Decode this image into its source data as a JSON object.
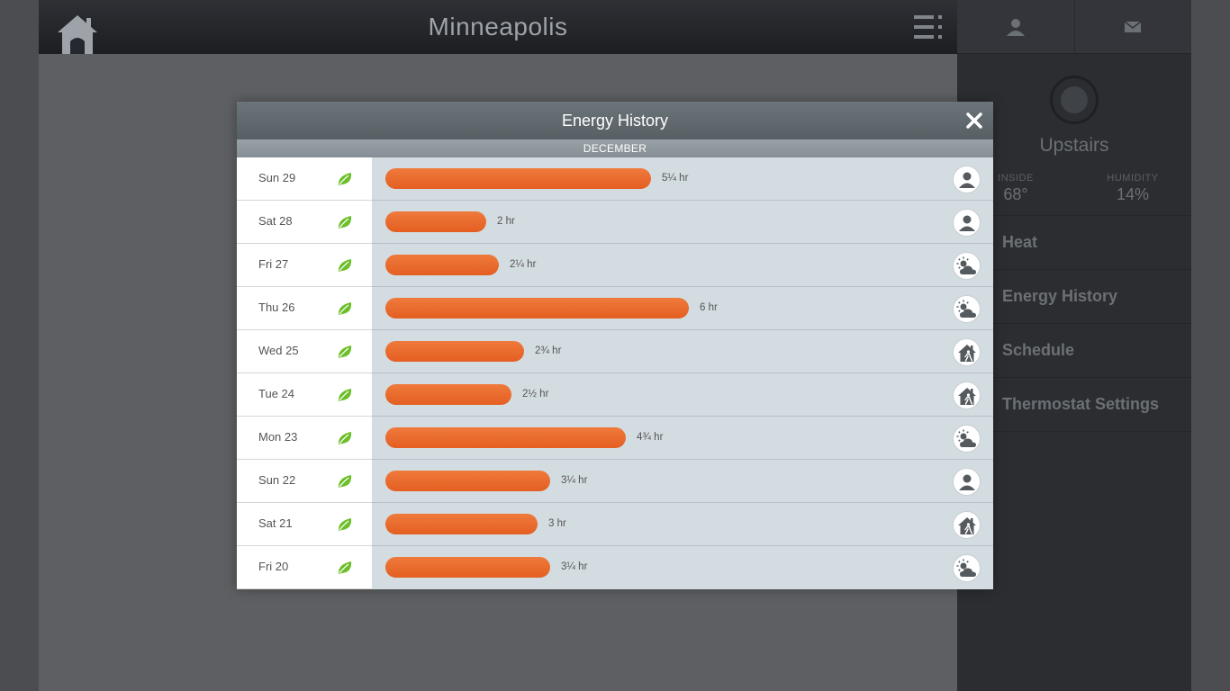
{
  "app": {
    "city": "Minneapolis"
  },
  "sidebar": {
    "device_name": "Upstairs",
    "inside_label": "INSIDE",
    "inside_value": "68°",
    "humidity_label": "HUMIDITY",
    "humidity_value": "14%",
    "nav": [
      {
        "label": "Heat"
      },
      {
        "label": "Energy History"
      },
      {
        "label": "Schedule"
      },
      {
        "label": "Thermostat Settings"
      }
    ]
  },
  "modal": {
    "title": "Energy History",
    "month": "DECEMBER"
  },
  "rows_max_hours": 6,
  "days": [
    {
      "day": "Sun 29",
      "hours": 5.25,
      "label": "5¼ hr",
      "reason": "user-icon"
    },
    {
      "day": "Sat 28",
      "hours": 2,
      "label": "2 hr",
      "reason": "user-icon"
    },
    {
      "day": "Fri 27",
      "hours": 2.25,
      "label": "2¼ hr",
      "reason": "weather-icon"
    },
    {
      "day": "Thu 26",
      "hours": 6,
      "label": "6 hr",
      "reason": "weather-icon"
    },
    {
      "day": "Wed 25",
      "hours": 2.75,
      "label": "2¾ hr",
      "reason": "away-icon"
    },
    {
      "day": "Tue 24",
      "hours": 2.5,
      "label": "2½ hr",
      "reason": "away-icon"
    },
    {
      "day": "Mon 23",
      "hours": 4.75,
      "label": "4¾ hr",
      "reason": "weather-icon"
    },
    {
      "day": "Sun 22",
      "hours": 3.25,
      "label": "3¼ hr",
      "reason": "user-icon"
    },
    {
      "day": "Sat 21",
      "hours": 3,
      "label": "3 hr",
      "reason": "away-icon"
    },
    {
      "day": "Fri 20",
      "hours": 3.25,
      "label": "3¼ hr",
      "reason": "weather-icon"
    }
  ],
  "colors": {
    "bar": "#e8652a",
    "leaf": "#6dbf2a"
  }
}
